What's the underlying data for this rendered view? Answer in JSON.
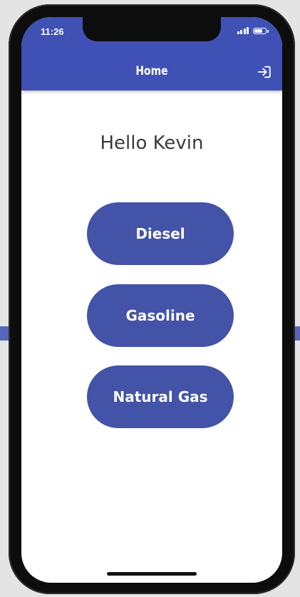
{
  "status_bar": {
    "time": "11:26",
    "battery_level": 0.8,
    "signal_bars": 4
  },
  "app_bar": {
    "title": "Home",
    "action_icon": "logout-icon",
    "color": "#3f51b5"
  },
  "main": {
    "greeting": "Hello Kevin",
    "buttons": [
      {
        "label": "Diesel"
      },
      {
        "label": "Gasoline"
      },
      {
        "label": "Natural Gas"
      }
    ],
    "button_color": "#4353a8"
  }
}
